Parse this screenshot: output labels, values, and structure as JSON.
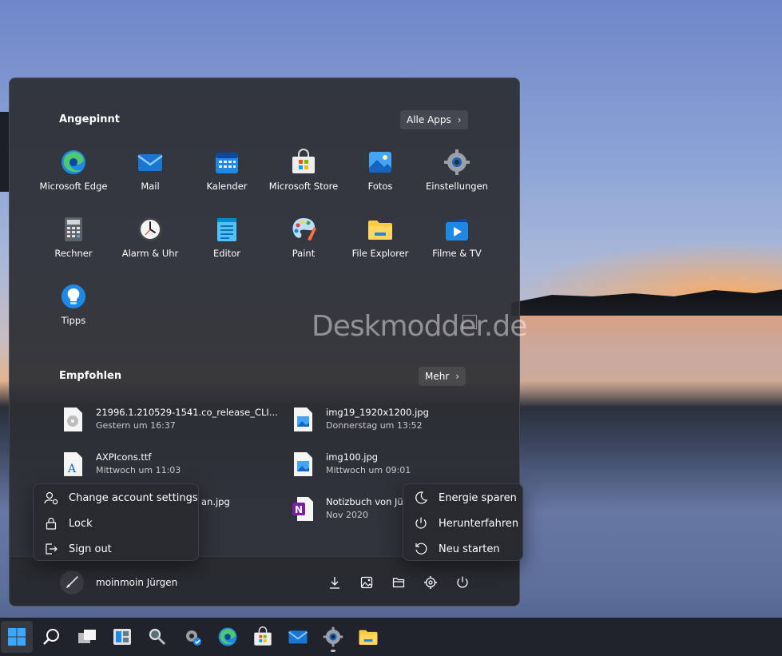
{
  "pinned": {
    "title": "Angepinnt",
    "all_apps": "Alle Apps",
    "apps": [
      {
        "label": "Microsoft Edge",
        "icon": "edge-icon"
      },
      {
        "label": "Mail",
        "icon": "mail-icon"
      },
      {
        "label": "Kalender",
        "icon": "calendar-icon"
      },
      {
        "label": "Microsoft Store",
        "icon": "store-icon"
      },
      {
        "label": "Fotos",
        "icon": "photos-icon"
      },
      {
        "label": "Einstellungen",
        "icon": "settings-icon"
      },
      {
        "label": "Rechner",
        "icon": "calculator-icon"
      },
      {
        "label": "Alarm & Uhr",
        "icon": "clock-icon"
      },
      {
        "label": "Editor",
        "icon": "notepad-icon"
      },
      {
        "label": "Paint",
        "icon": "paint-icon"
      },
      {
        "label": "File Explorer",
        "icon": "folder-icon"
      },
      {
        "label": "Filme & TV",
        "icon": "movies-icon"
      },
      {
        "label": "Tipps",
        "icon": "tips-icon"
      }
    ]
  },
  "watermark": "Deskmodder.de",
  "recommended": {
    "title": "Empfohlen",
    "more": "Mehr",
    "items": [
      {
        "name": "21996.1.210529-1541.co_release_CLI...",
        "time": "Gestern um 16:37"
      },
      {
        "name": "img19_1920x1200.jpg",
        "time": "Donnerstag um 13:52"
      },
      {
        "name": "AXPIcons.ttf",
        "time": "Mittwoch um 11:03"
      },
      {
        "name": "img100.jpg",
        "time": "Mittwoch um 09:01"
      },
      {
        "name": "an.jpg",
        "time": ""
      },
      {
        "name": "Notizbuch von Jür",
        "time": "Nov 2020"
      }
    ]
  },
  "user": {
    "name": "moinmoin Jürgen"
  },
  "account_menu": {
    "items": [
      "Change account settings",
      "Lock",
      "Sign out"
    ]
  },
  "power_menu": {
    "items": [
      "Energie sparen",
      "Herunterfahren",
      "Neu starten"
    ]
  }
}
